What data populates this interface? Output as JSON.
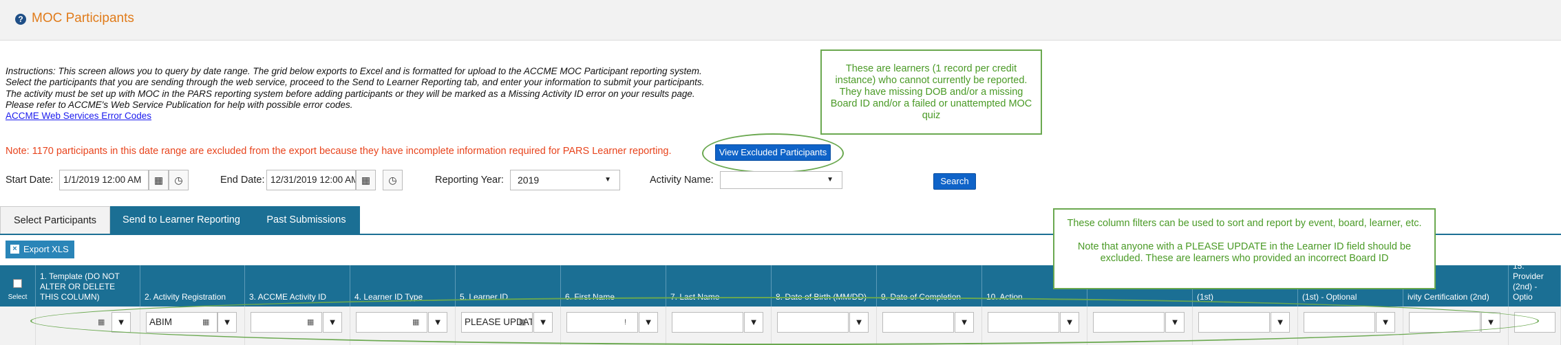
{
  "page": {
    "title": "MOC Participants"
  },
  "instructions": {
    "lines": [
      "Instructions: This screen allows you to query by date range. The grid below exports to Excel and is formatted for upload to the ACCME MOC Participant reporting system.",
      "Select the participants that you are sending through the web service, proceed to the Send to Learner Reporting tab, and enter your information to submit your participants.",
      "The activity must be set up with MOC in the PARS reporting system before adding participants or they will be marked as a Missing Activity ID error on your results page.",
      "Please refer to ACCME's Web Service Publication for help with possible error codes."
    ],
    "link": "ACCME Web Services Error Codes"
  },
  "callouts": {
    "excluded": "These are learners (1 record per credit instance) who cannot currently be reported. They have missing DOB and/or a missing Board ID and/or a failed or unattempted MOC quiz",
    "filters_line1": "These column filters can be used to sort and report by event, board, learner, etc.",
    "filters_line2": "Note that anyone with a PLEASE UPDATE in the Learner ID field should be excluded.  These are learners who provided an incorrect Board ID"
  },
  "note": {
    "text": "Note: 1170 participants in this date range are excluded from the export because they have incomplete information required for PARS Learner reporting.",
    "button": "View Excluded Participants"
  },
  "filters": {
    "start_label": "Start Date:",
    "start_value": "1/1/2019 12:00 AM",
    "end_label": "End Date:",
    "end_value": "12/31/2019 12:00 AM",
    "year_label": "Reporting Year:",
    "year_value": "2019",
    "activity_label": "Activity Name:",
    "activity_value": "",
    "search_button": "Search"
  },
  "tabs": [
    "Select Participants",
    "Send to Learner Reporting",
    "Past Submissions"
  ],
  "export_button": "Export XLS",
  "grid": {
    "select_label": "Select",
    "columns": [
      "1. Template (DO NOT ALTER OR DELETE THIS COLUMN)",
      "2. Activity Registration",
      "3. ACCME Activity ID",
      "4. Learner ID Type",
      "5. Learner ID",
      "6. First Name",
      "7. Last Name",
      "8. Date of Birth (MM/DD) -",
      "9. Date of Completion",
      "10. Action",
      "",
      "(1st)",
      "(1st) - Optional",
      "ivity Certification (2nd)",
      "15. Provider (2nd) - Optio"
    ],
    "filter_values": [
      "",
      "ABIM",
      "",
      "",
      "PLEASE UPDATE",
      "",
      "",
      "",
      "",
      "",
      "",
      "",
      "",
      "",
      ""
    ]
  }
}
